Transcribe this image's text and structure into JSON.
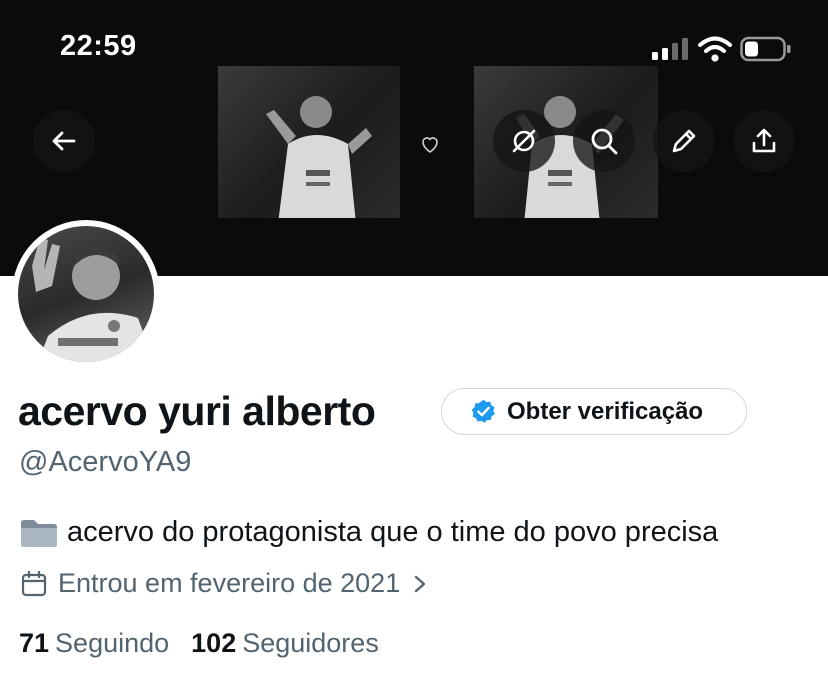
{
  "status_bar": {
    "time": "22:59"
  },
  "header": {
    "back_icon": "arrow-left-icon",
    "translate_icon": "translate-off-icon",
    "search_icon": "search-icon",
    "edit_icon": "pencil-icon",
    "share_icon": "share-upload-icon"
  },
  "profile": {
    "display_name": "acervo yuri alberto",
    "verify_button_label": "Obter verificação",
    "handle": "@AcervoYA9",
    "bio": "acervo do protagonista que o time do povo precisa",
    "bio_emoji": "folder-icon",
    "joined": "Entrou em fevereiro de 2021",
    "following_count": "71",
    "following_label": "Seguindo",
    "followers_count": "102",
    "followers_label": "Seguidores"
  },
  "colors": {
    "text_primary": "#0f1419",
    "text_secondary": "#536471",
    "verified_blue": "#1d9bf0",
    "banner_bg": "#0b0b0b"
  }
}
